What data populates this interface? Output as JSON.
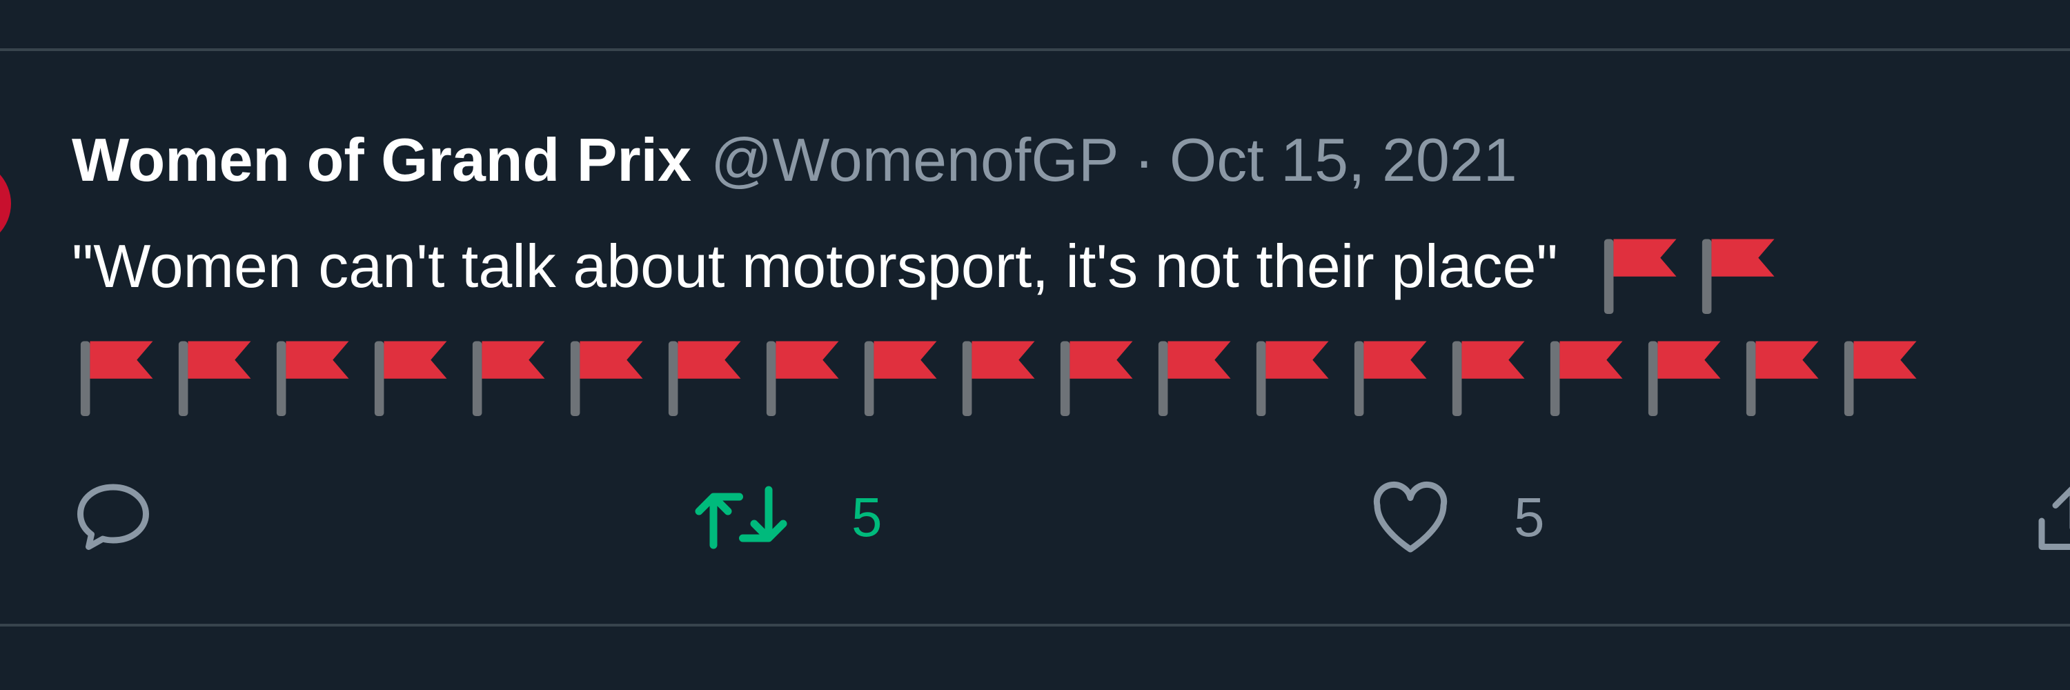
{
  "tweet": {
    "display_name": "Women of Grand Prix",
    "handle": "@WomenofGP",
    "separator": "·",
    "date": "Oct 15, 2021",
    "text": "\"Women can't talk about motorsport, it's not their place\"",
    "emoji": "🚩",
    "emoji_count_first_line": 2,
    "emoji_count_second_line": 19
  },
  "actions": {
    "reply": {
      "icon": "reply-icon"
    },
    "retweet": {
      "icon": "retweet-icon",
      "count": "5",
      "color": "#00ba7c"
    },
    "like": {
      "icon": "heart-icon",
      "count": "5",
      "color": "#8b98a5"
    },
    "share": {
      "icon": "share-icon"
    }
  },
  "colors": {
    "background": "#15202b",
    "divider": "#38444d",
    "text_primary": "#ffffff",
    "text_secondary": "#8b98a5",
    "flag_red": "#e0303e",
    "flag_pole": "#6e7378"
  }
}
